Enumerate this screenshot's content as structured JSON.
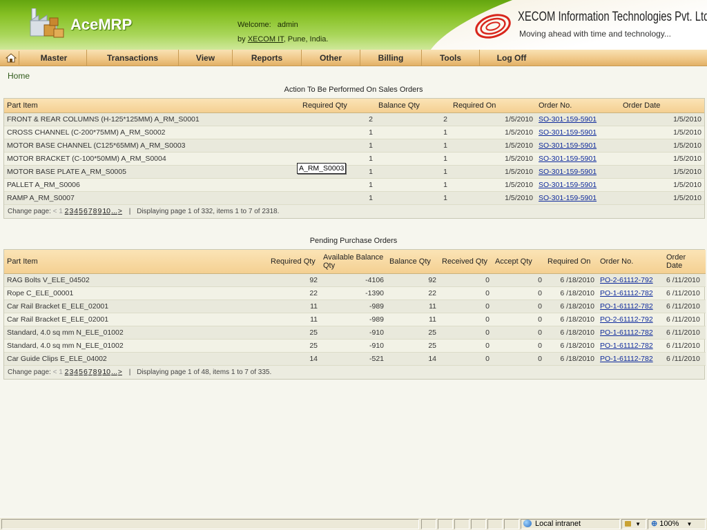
{
  "header": {
    "app_name": "AceMRP",
    "welcome_label": "Welcome:",
    "welcome_user": "admin",
    "by_prefix": "by",
    "by_link": "XECOM IT",
    "by_suffix": ", Pune, India.",
    "company_name": "XECOM Information Technologies Pvt. Ltd.",
    "company_tagline": "Moving ahead with time and technology...",
    "brand_green": "#86c024",
    "xecom_red": "#d8261c"
  },
  "nav": {
    "items": [
      "Master",
      "Transactions",
      "View",
      "Reports",
      "Other",
      "Billing",
      "Tools",
      "Log Off"
    ]
  },
  "breadcrumb": "Home",
  "sales": {
    "title": "Action To Be Performed On Sales Orders",
    "columns": [
      "Part Item",
      "Required Qty",
      "Balance Qty",
      "Required On",
      "Order No.",
      "Order Date"
    ],
    "rows": [
      [
        "FRONT & REAR COLUMNS (H-125*125MM) A_RM_S0001",
        "2",
        "2",
        "1/5/2010",
        "SO-301-159-5901",
        "1/5/2010"
      ],
      [
        "CROSS CHANNEL (C-200*75MM) A_RM_S0002",
        "1",
        "1",
        "1/5/2010",
        "SO-301-159-5901",
        "1/5/2010"
      ],
      [
        "MOTOR BASE CHANNEL (C125*65MM) A_RM_S0003",
        "1",
        "1",
        "1/5/2010",
        "SO-301-159-5901",
        "1/5/2010"
      ],
      [
        "MOTOR BRACKET (C-100*50MM) A_RM_S0004",
        "1",
        "1",
        "1/5/2010",
        "SO-301-159-5901",
        "1/5/2010"
      ],
      [
        "MOTOR BASE PLATE A_RM_S0005",
        "1",
        "1",
        "1/5/2010",
        "SO-301-159-5901",
        "1/5/2010"
      ],
      [
        "PALLET A_RM_S0006",
        "1",
        "1",
        "1/5/2010",
        "SO-301-159-5901",
        "1/5/2010"
      ],
      [
        "RAMP A_RM_S0007",
        "1",
        "1",
        "1/5/2010",
        "SO-301-159-5901",
        "1/5/2010"
      ]
    ],
    "pager": {
      "label": "Change page:",
      "prev": "<",
      "current": "1",
      "pages": [
        "2",
        "3",
        "4",
        "5",
        "6",
        "7",
        "8",
        "9",
        "10",
        "...",
        ">"
      ],
      "summary": "Displaying page 1 of 332, items 1 to 7 of 2318."
    }
  },
  "tooltip": "A_RM_S0003",
  "purchase": {
    "title": "Pending Purchase Orders",
    "columns": [
      "Part Item",
      "Required Qty",
      "Available Balance Qty",
      "Balance Qty",
      "Received Qty",
      "Accept Qty",
      "Required On",
      "Order No.",
      "Order Date"
    ],
    "rows": [
      [
        "RAG Bolts V_ELE_04502",
        "92",
        "-4106",
        "92",
        "0",
        "0",
        "6 /18/2010",
        "PO-2-61112-792",
        "6 /11/2010"
      ],
      [
        "Rope C_ELE_00001",
        "22",
        "-1390",
        "22",
        "0",
        "0",
        "6 /18/2010",
        "PO-1-61112-782",
        "6 /11/2010"
      ],
      [
        "Car Rail Bracket E_ELE_02001",
        "11",
        "-989",
        "11",
        "0",
        "0",
        "6 /18/2010",
        "PO-1-61112-782",
        "6 /11/2010"
      ],
      [
        "Car Rail Bracket E_ELE_02001",
        "11",
        "-989",
        "11",
        "0",
        "0",
        "6 /18/2010",
        "PO-2-61112-792",
        "6 /11/2010"
      ],
      [
        "Standard, 4.0 sq mm N_ELE_01002",
        "25",
        "-910",
        "25",
        "0",
        "0",
        "6 /18/2010",
        "PO-1-61112-782",
        "6 /11/2010"
      ],
      [
        "Standard, 4.0 sq mm N_ELE_01002",
        "25",
        "-910",
        "25",
        "0",
        "0",
        "6 /18/2010",
        "PO-1-61112-782",
        "6 /11/2010"
      ],
      [
        "Car Guide Clips E_ELE_04002",
        "14",
        "-521",
        "14",
        "0",
        "0",
        "6 /18/2010",
        "PO-1-61112-782",
        "6 /11/2010"
      ]
    ],
    "pager": {
      "label": "Change page:",
      "prev": "<",
      "current": "1",
      "pages": [
        "2",
        "3",
        "4",
        "5",
        "6",
        "7",
        "8",
        "9",
        "10",
        "...",
        ">"
      ],
      "summary": "Displaying page 1 of 48, items 1 to 7 of 335."
    }
  },
  "statusbar": {
    "zone": "Local intranet",
    "zoom": "100%"
  }
}
